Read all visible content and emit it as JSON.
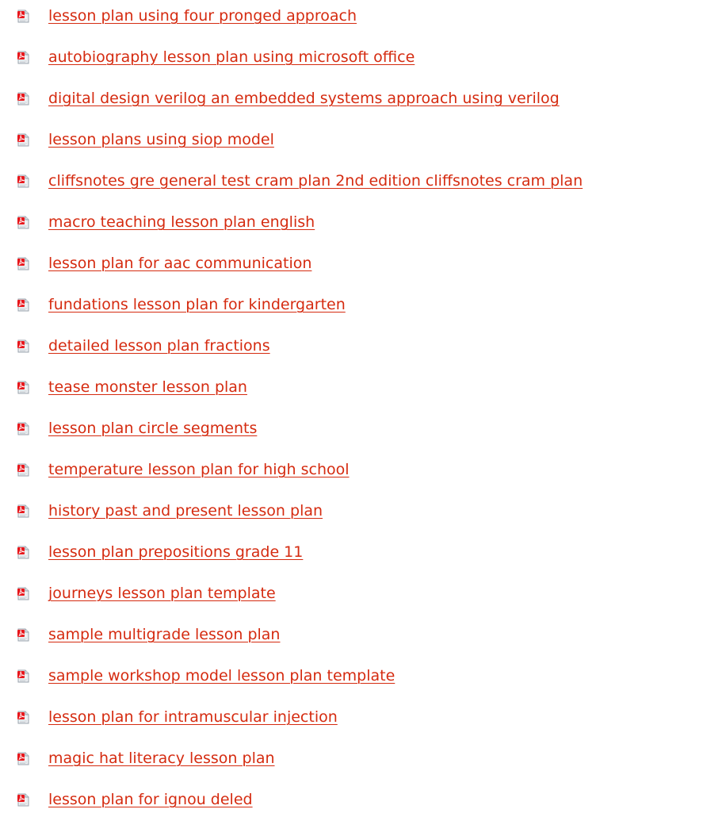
{
  "colors": {
    "link": "#d52b10",
    "icon_red": "#e8161b",
    "icon_paper": "#eef0f2"
  },
  "icon_name": "pdf-file-icon",
  "items": [
    {
      "label": "lesson plan using four pronged approach"
    },
    {
      "label": "autobiography lesson plan using microsoft office"
    },
    {
      "label": "digital design verilog an embedded systems approach using verilog"
    },
    {
      "label": "lesson plans using siop model"
    },
    {
      "label": "cliffsnotes gre general test cram plan 2nd edition cliffsnotes cram plan"
    },
    {
      "label": "macro teaching lesson plan english"
    },
    {
      "label": "lesson plan for aac communication"
    },
    {
      "label": "fundations lesson plan for kindergarten"
    },
    {
      "label": "detailed lesson plan fractions"
    },
    {
      "label": "tease monster lesson plan"
    },
    {
      "label": "lesson plan circle segments"
    },
    {
      "label": "temperature lesson plan for high school"
    },
    {
      "label": "history past and present lesson plan"
    },
    {
      "label": "lesson plan prepositions grade 11"
    },
    {
      "label": "journeys lesson plan template"
    },
    {
      "label": "sample multigrade lesson plan"
    },
    {
      "label": "sample workshop model lesson plan template"
    },
    {
      "label": "lesson plan for intramuscular injection"
    },
    {
      "label": "magic hat literacy lesson plan"
    },
    {
      "label": "lesson plan for ignou deled"
    }
  ]
}
